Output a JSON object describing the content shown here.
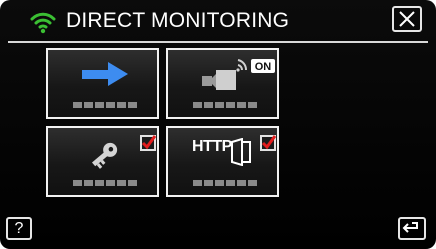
{
  "header": {
    "title": "DIRECT MONITORING",
    "wifi_icon": "wifi-icon",
    "close_icon": "close-icon",
    "wifi_color": "#3bbf33"
  },
  "tiles": [
    {
      "icon": "arrow-right-icon",
      "accent": "#3d8cf0"
    },
    {
      "icon": "camera-broadcast-on-icon",
      "badge": "ON"
    },
    {
      "icon": "key-icon",
      "checked": true,
      "check_color": "#e31c1c"
    },
    {
      "icon": "http-document-icon",
      "text": "HTTP",
      "checked": true,
      "check_color": "#e31c1c"
    }
  ],
  "footer": {
    "help_label": "?",
    "back_icon": "back-arrow-icon"
  }
}
